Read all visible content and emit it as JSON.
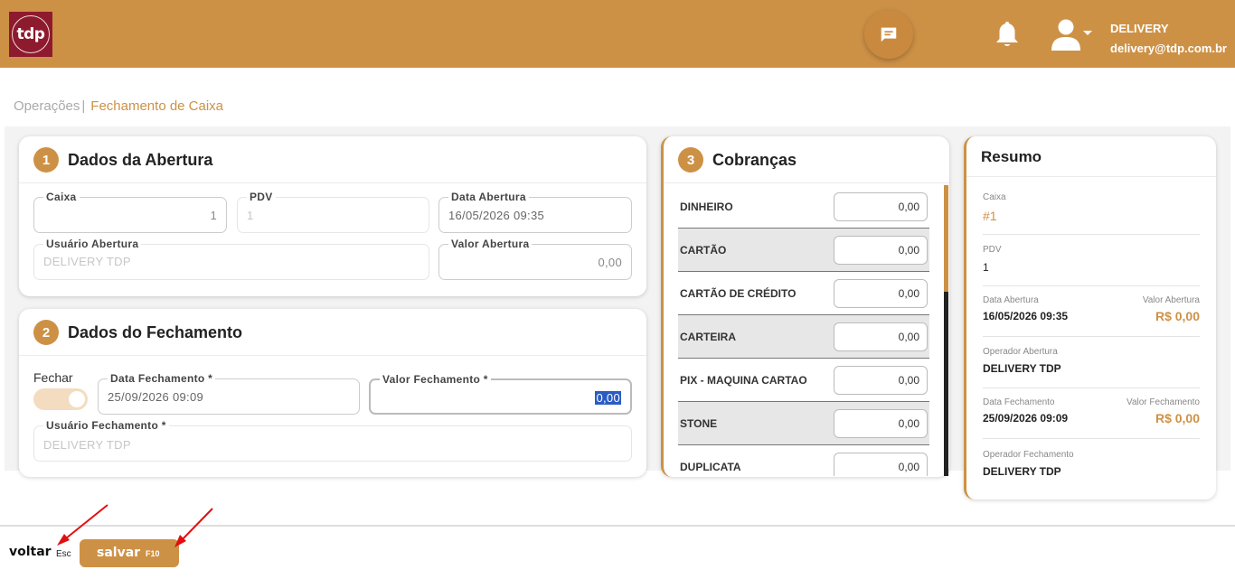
{
  "header": {
    "logo_text": "tdp",
    "user_name": "DELIVERY",
    "user_email": "delivery@tdp.com.br",
    "accent_color": "#cd9146"
  },
  "breadcrumb": {
    "parent": "Operações",
    "separator": "|",
    "current": "Fechamento de Caixa"
  },
  "abertura": {
    "step": "1",
    "title": "Dados da Abertura",
    "caixa_label": "Caixa",
    "caixa_value": "1",
    "pdv_label": "PDV",
    "pdv_value": "1",
    "data_label": "Data Abertura",
    "data_value": "16/05/2026 09:35",
    "usuario_label": "Usuário Abertura",
    "usuario_value": "DELIVERY TDP",
    "valor_label": "Valor Abertura",
    "valor_value": "0,00"
  },
  "fechamento": {
    "step": "2",
    "title": "Dados do Fechamento",
    "fechar_label": "Fechar",
    "fechar_on": true,
    "data_label": "Data Fechamento *",
    "data_value": "25/09/2026 09:09",
    "valor_label": "Valor Fechamento *",
    "valor_value": "0,00",
    "usuario_label": "Usuário Fechamento *",
    "usuario_value": "DELIVERY TDP"
  },
  "cobrancas": {
    "step": "3",
    "title": "Cobranças",
    "items": [
      {
        "name": "DINHEIRO",
        "value": "0,00"
      },
      {
        "name": "CARTÃO",
        "value": "0,00"
      },
      {
        "name": "CARTÃO DE CRÉDITO",
        "value": "0,00"
      },
      {
        "name": "CARTEIRA",
        "value": "0,00"
      },
      {
        "name": "PIX - MAQUINA CARTAO",
        "value": "0,00"
      },
      {
        "name": "STONE",
        "value": "0,00"
      },
      {
        "name": "DUPLICATA",
        "value": "0,00"
      }
    ]
  },
  "resumo": {
    "title": "Resumo",
    "caixa_label": "Caixa",
    "caixa_value": "#1",
    "pdv_label": "PDV",
    "pdv_value": "1",
    "data_abertura_label": "Data Abertura",
    "data_abertura_value": "16/05/2026 09:35",
    "valor_abertura_label": "Valor Abertura",
    "valor_abertura_value": "R$ 0,00",
    "operador_abertura_label": "Operador Abertura",
    "operador_abertura_value": "DELIVERY TDP",
    "data_fechamento_label": "Data Fechamento",
    "data_fechamento_value": "25/09/2026 09:09",
    "valor_fechamento_label": "Valor Fechamento",
    "valor_fechamento_value": "R$ 0,00",
    "operador_fechamento_label": "Operador Fechamento",
    "operador_fechamento_value": "DELIVERY TDP"
  },
  "footer": {
    "voltar_label": "voltar",
    "voltar_key": "Esc",
    "salvar_label": "salvar",
    "salvar_key": "F10"
  }
}
